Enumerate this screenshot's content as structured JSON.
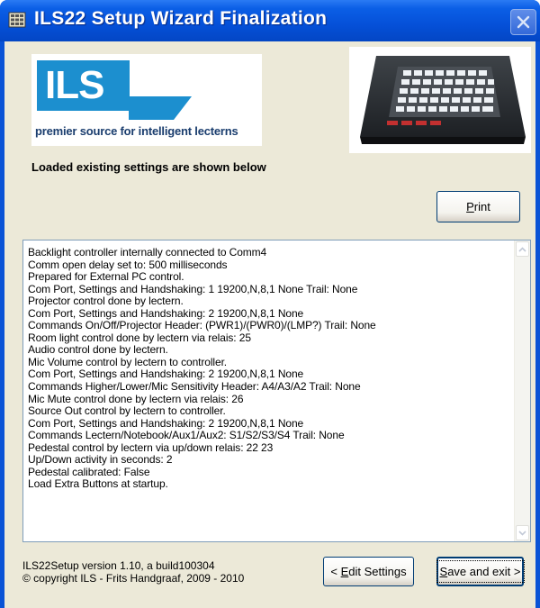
{
  "window": {
    "title": "ILS22 Setup Wizard Finalization"
  },
  "logo": {
    "letters": "ILS",
    "tagline": "premier source for intelligent lecterns"
  },
  "status_text": "Loaded existing settings are shown below",
  "buttons": {
    "print": {
      "before": "",
      "mnemonic": "P",
      "after": "rint"
    },
    "edit": {
      "before": "< ",
      "mnemonic": "E",
      "after": "dit Settings"
    },
    "save": {
      "before": "",
      "mnemonic": "S",
      "after": "ave and exit >"
    }
  },
  "log_lines": [
    "Backlight controller internally connected to Comm4",
    "Comm open delay set to: 500 milliseconds",
    "Prepared for External PC control.",
    "Com Port, Settings and Handshaking: 1 19200,N,8,1 None Trail: None",
    "Projector control done by lectern.",
    "Com Port, Settings and Handshaking: 2 19200,N,8,1 None",
    "Commands On/Off/Projector Header: (PWR1)/(PWR0)/(LMP?) Trail: None",
    "Room light control done by lectern via relais: 25",
    "Audio control done by lectern.",
    "Mic Volume control by lectern to controller.",
    "Com Port, Settings and Handshaking: 2 19200,N,8,1 None",
    "Commands Higher/Lower/Mic Sensitivity Header: A4/A3/A2 Trail: None",
    "Mic Mute control done by lectern via relais: 26",
    "Source Out control by lectern to controller.",
    "Com Port, Settings and Handshaking: 2 19200,N,8,1 None",
    "Commands Lectern/Notebook/Aux1/Aux2: S1/S2/S3/S4 Trail: None",
    "Pedestal control by lectern via up/down relais: 22 23",
    "Up/Down activity in seconds: 2",
    "Pedestal calibrated: False",
    "Load Extra Buttons at startup."
  ],
  "version": {
    "line1": "ILS22Setup version 1.10, a build100304",
    "line2": "© copyright ILS - Frits Handgraaf, 2009 - 2010"
  },
  "icons": {
    "app": "keypad-app-icon",
    "close": "close-icon",
    "scroll_up": "chevron-up-icon",
    "scroll_down": "chevron-down-icon"
  },
  "colors": {
    "titlebar": "#0550d8",
    "dialog_bg": "#ece9d8",
    "logo_blue": "#1c8fcf",
    "button_border": "#003c74"
  }
}
